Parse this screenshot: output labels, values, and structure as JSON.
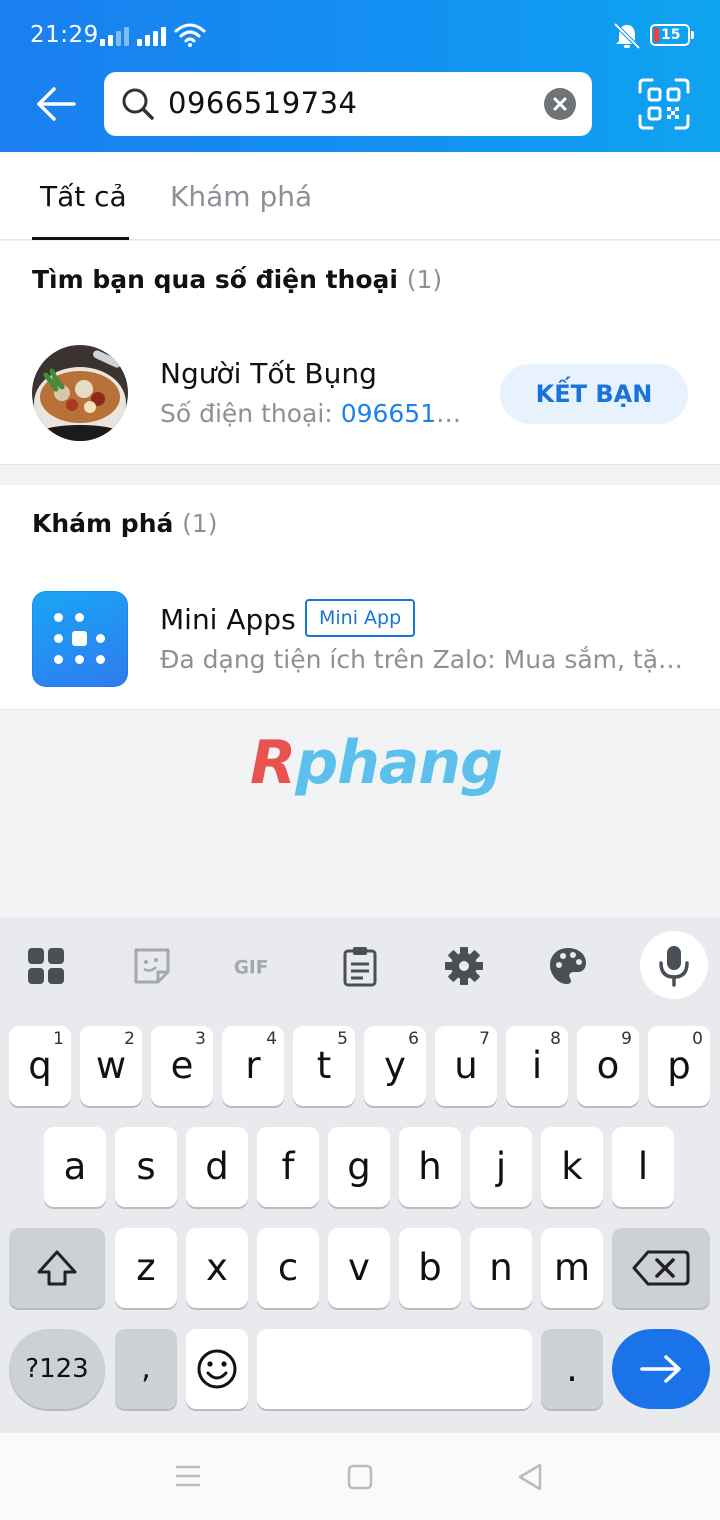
{
  "status_bar": {
    "time": "21:29",
    "battery_level": "15"
  },
  "header": {
    "search_value": "0966519734"
  },
  "tabs": [
    {
      "label": "Tất cả"
    },
    {
      "label": "Khám phá"
    }
  ],
  "friends_section": {
    "title": "Tìm bạn qua số điện thoại",
    "count": "(1)",
    "result": {
      "name": "Người Tốt Bụng",
      "phone_label": "Số điện thoại: ",
      "phone": "0966519...",
      "button": "KẾT BẠN"
    }
  },
  "discover_section": {
    "title": "Khám phá",
    "count": "(1)",
    "result": {
      "name": "Mini Apps",
      "badge": "Mini App",
      "description": "Đa dạng tiện ích trên Zalo: Mua sắm, tặng qu..."
    }
  },
  "watermark": {
    "first": "R",
    "rest": "phang"
  },
  "keyboard": {
    "row1": [
      {
        "k": "q",
        "h": "1"
      },
      {
        "k": "w",
        "h": "2"
      },
      {
        "k": "e",
        "h": "3"
      },
      {
        "k": "r",
        "h": "4"
      },
      {
        "k": "t",
        "h": "5"
      },
      {
        "k": "y",
        "h": "6"
      },
      {
        "k": "u",
        "h": "7"
      },
      {
        "k": "i",
        "h": "8"
      },
      {
        "k": "o",
        "h": "9"
      },
      {
        "k": "p",
        "h": "0"
      }
    ],
    "row2": [
      "a",
      "s",
      "d",
      "f",
      "g",
      "h",
      "j",
      "k",
      "l"
    ],
    "row3": [
      "z",
      "x",
      "c",
      "v",
      "b",
      "n",
      "m"
    ],
    "symbols_key": "?123",
    "comma_key": ",",
    "period_key": "."
  },
  "colors": {
    "header_blue": "#1a84e8",
    "link_blue": "#1a84e8",
    "enter_key": "#1a73e8"
  }
}
